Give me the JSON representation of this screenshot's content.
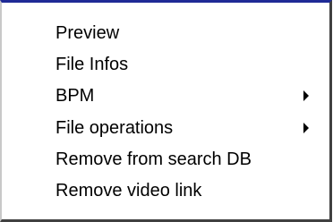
{
  "menu": {
    "items": [
      {
        "label": "Preview",
        "submenu": false
      },
      {
        "label": "File Infos",
        "submenu": false
      },
      {
        "label": "BPM",
        "submenu": true
      },
      {
        "label": "File operations",
        "submenu": true
      },
      {
        "label": "Remove from search DB",
        "submenu": false
      },
      {
        "label": "Remove video link",
        "submenu": false
      }
    ]
  },
  "colors": {
    "border_top": "#1f2a96",
    "border_shadow": "#404040",
    "background": "#ffffff",
    "text": "#000000"
  },
  "icons": {
    "submenu_arrow": "chevron-right-icon"
  }
}
